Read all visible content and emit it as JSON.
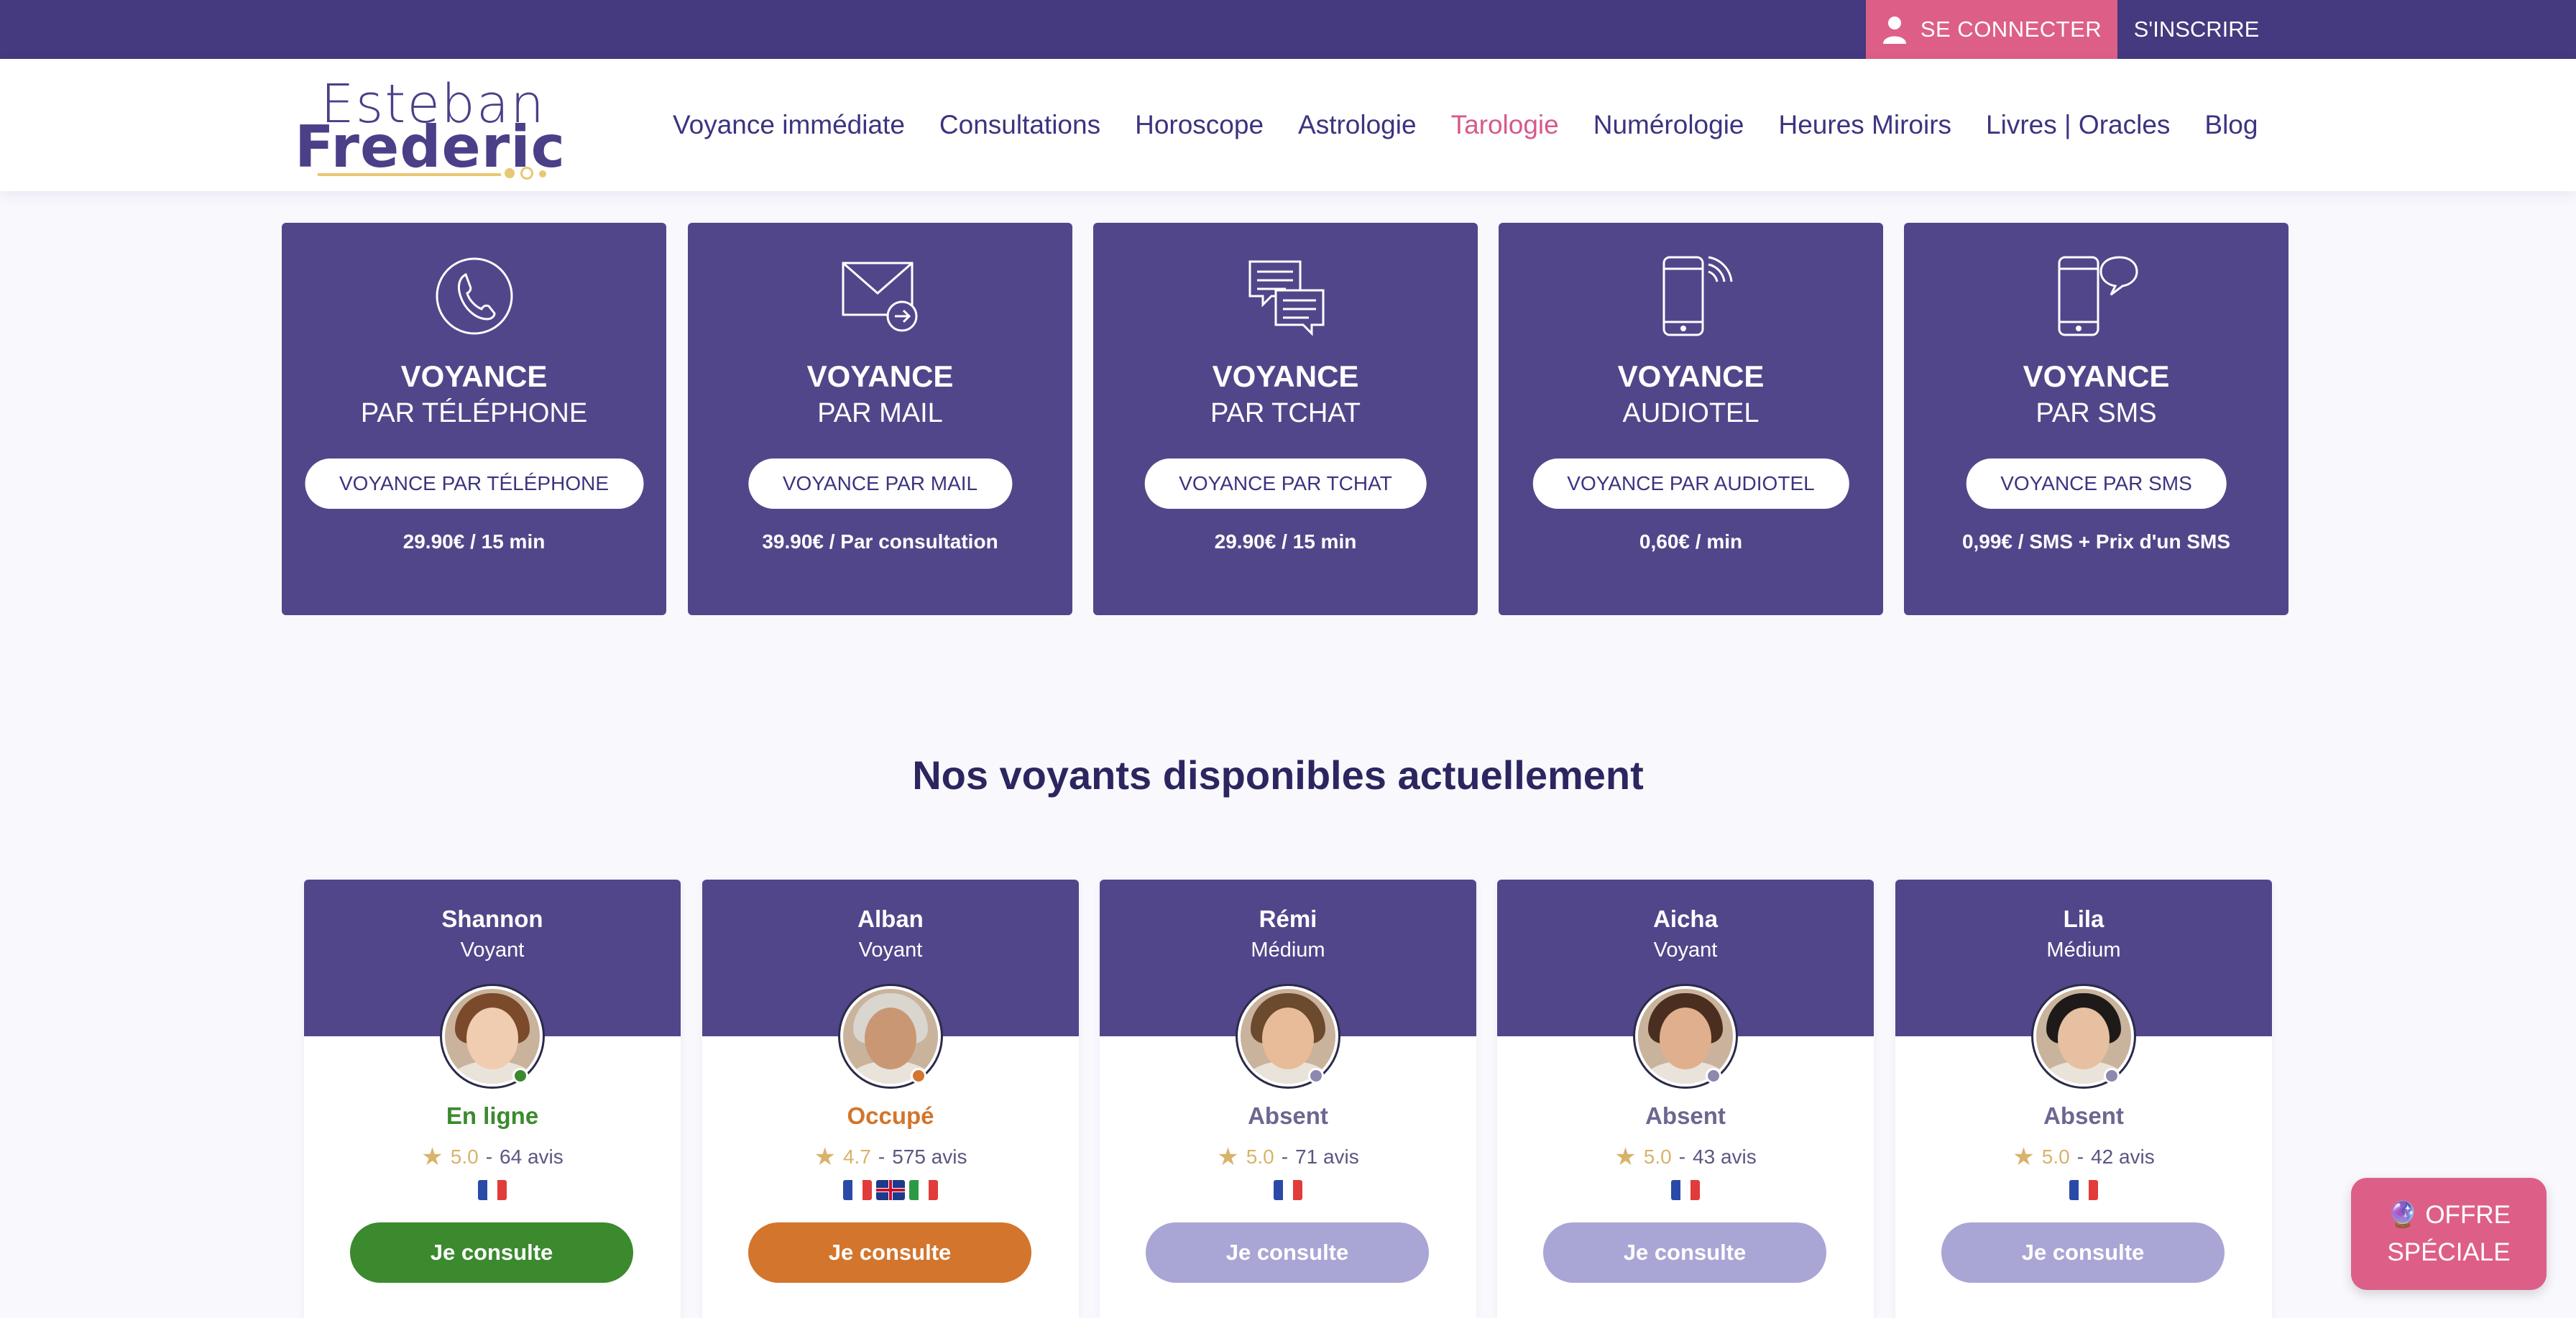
{
  "topbar": {
    "login_label": "SE CONNECTER",
    "signup_label": "S'INSCRIRE",
    "login_color": "#dd5f88",
    "bar_color": "#45397f"
  },
  "header": {
    "logo": {
      "line1": "Esteban",
      "line2": "Frederic"
    },
    "nav": [
      {
        "label": "Voyance immédiate",
        "active": false
      },
      {
        "label": "Consultations",
        "active": false
      },
      {
        "label": "Horoscope",
        "active": false
      },
      {
        "label": "Astrologie",
        "active": false
      },
      {
        "label": "Tarologie",
        "active": true
      },
      {
        "label": "Numérologie",
        "active": false
      },
      {
        "label": "Heures Miroirs",
        "active": false
      },
      {
        "label": "Livres | Oracles",
        "active": false
      },
      {
        "label": "Blog",
        "active": false
      }
    ]
  },
  "services": [
    {
      "icon": "phone-icon",
      "title": "VOYANCE",
      "subtitle": "PAR TÉLÉPHONE",
      "button": "VOYANCE PAR TÉLÉPHONE",
      "price": "29.90€ / 15 min"
    },
    {
      "icon": "mail-icon",
      "title": "VOYANCE",
      "subtitle": "PAR MAIL",
      "button": "VOYANCE PAR MAIL",
      "price": "39.90€ / Par consultation"
    },
    {
      "icon": "chat-icon",
      "title": "VOYANCE",
      "subtitle": "PAR TCHAT",
      "button": "VOYANCE PAR TCHAT",
      "price": "29.90€ / 15 min"
    },
    {
      "icon": "mobile-audio-icon",
      "title": "VOYANCE",
      "subtitle": "AUDIOTEL",
      "button": "VOYANCE PAR AUDIOTEL",
      "price": "0,60€ / min"
    },
    {
      "icon": "mobile-sms-icon",
      "title": "VOYANCE",
      "subtitle": "PAR SMS",
      "button": "VOYANCE PAR SMS",
      "price": "0,99€ / SMS + Prix d'un SMS"
    }
  ],
  "section_title": "Nos voyants disponibles actuellement",
  "psychics": [
    {
      "name": "Shannon",
      "role": "Voyant",
      "status": "En ligne",
      "status_color": "#3b8a2e",
      "rating": "5.0",
      "separator": "-",
      "reviews": "64 avis",
      "flags": [
        "fr"
      ],
      "button": "Je consulte",
      "button_color": "#3b8a2e",
      "hair": "#7a4a2a",
      "skin": "#f0ccb0"
    },
    {
      "name": "Alban",
      "role": "Voyant",
      "status": "Occupé",
      "status_color": "#d3752c",
      "rating": "4.7",
      "separator": "-",
      "reviews": "575 avis",
      "flags": [
        "fr",
        "uk",
        "it"
      ],
      "button": "Je consulte",
      "button_color": "#d3752c",
      "hair": "#d9d6d0",
      "skin": "#c99773"
    },
    {
      "name": "Rémi",
      "role": "Médium",
      "status": "Absent",
      "status_color": "#6b6791",
      "rating": "5.0",
      "separator": "-",
      "reviews": "71 avis",
      "flags": [
        "fr"
      ],
      "button": "Je consulte",
      "button_color": "#a9a6d6",
      "hair": "#6b4a2e",
      "skin": "#e8bc98"
    },
    {
      "name": "Aicha",
      "role": "Voyant",
      "status": "Absent",
      "status_color": "#6b6791",
      "rating": "5.0",
      "separator": "-",
      "reviews": "43 avis",
      "flags": [
        "fr"
      ],
      "button": "Je consulte",
      "button_color": "#a9a6d6",
      "hair": "#4a2f20",
      "skin": "#e0b08e"
    },
    {
      "name": "Lila",
      "role": "Médium",
      "status": "Absent",
      "status_color": "#6b6791",
      "rating": "5.0",
      "separator": "-",
      "reviews": "42 avis",
      "flags": [
        "fr"
      ],
      "button": "Je consulte",
      "button_color": "#a9a6d6",
      "hair": "#1e1a1a",
      "skin": "#e6c0a0"
    }
  ],
  "offer": {
    "icon": "crystal-ball-icon",
    "line1": "🔮 OFFRE",
    "line2": "SPÉCIALE"
  }
}
